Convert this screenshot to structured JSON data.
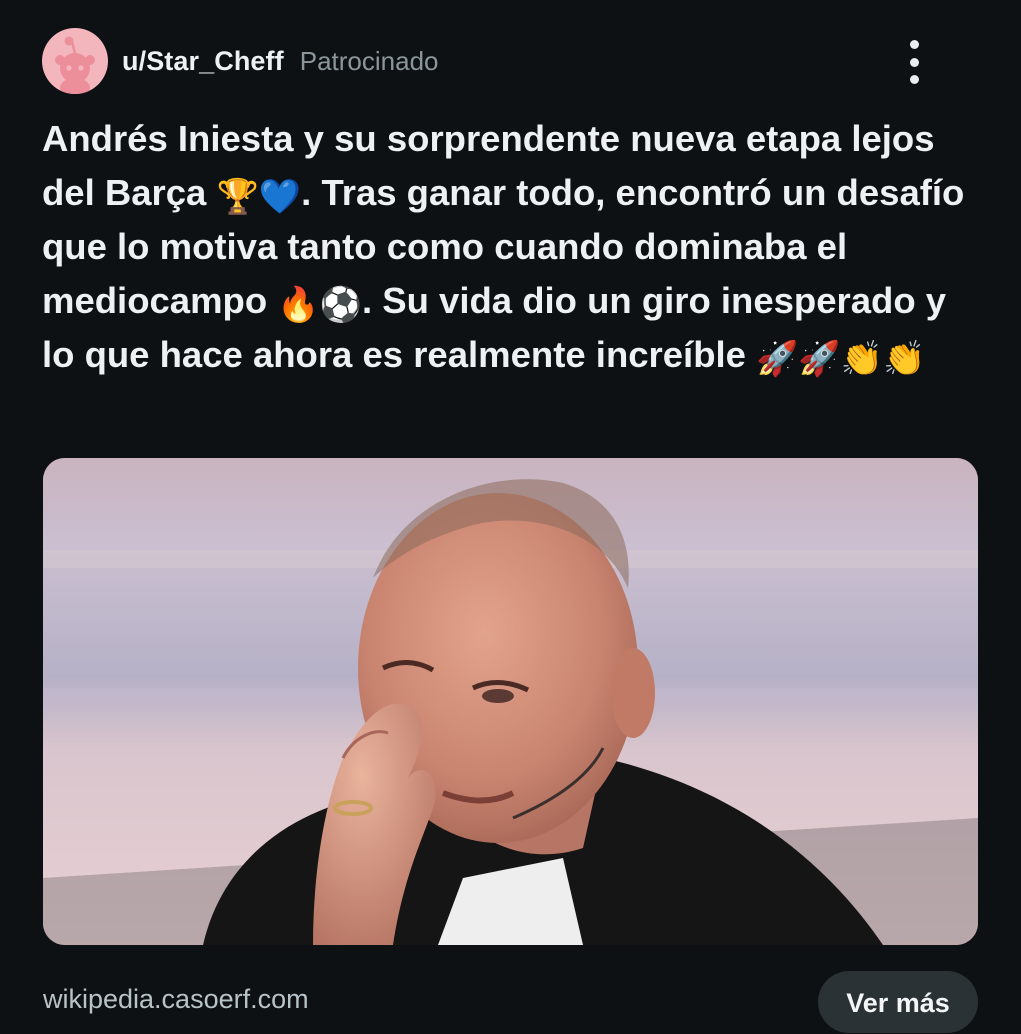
{
  "post": {
    "author": "u/Star_Cheff",
    "sponsored_label": "Patrocinado",
    "title_parts": {
      "p1": "Andrés Iniesta y su sorprendente nueva etapa lejos del Barça ",
      "e_trophy": "🏆",
      "e_heart": "💙",
      "p2": ". Tras ganar todo, encontró un desafío que lo motiva tanto como cuando dominaba el mediocampo ",
      "e_fire": "🔥",
      "e_ball": "⚽",
      "p3": ". Su vida dio un giro inesperado y lo que hace ahora es realmente increíble ",
      "e_rocket1": "🚀",
      "e_rocket2": "🚀",
      "e_clap1": "👏",
      "e_clap2": "👏"
    },
    "link_domain": "wikipedia.casoerf.com",
    "cta_label": "Ver más"
  },
  "icons": {
    "avatar": "snoo-avatar-icon",
    "menu": "more-vertical-icon"
  },
  "colors": {
    "background": "#0e1113",
    "avatar_bg": "#f3b6bd",
    "cta_bg": "#2a3236",
    "muted_text": "#8b969c"
  }
}
